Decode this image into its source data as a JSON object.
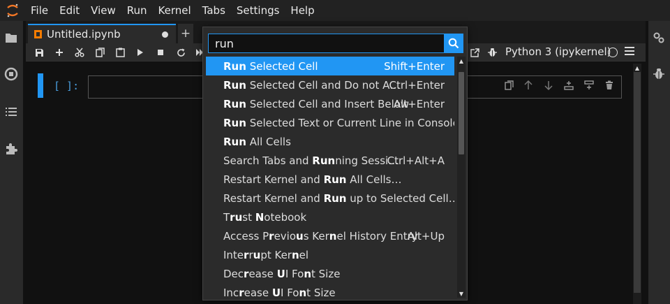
{
  "menubar": {
    "items": [
      "File",
      "Edit",
      "View",
      "Run",
      "Kernel",
      "Tabs",
      "Settings",
      "Help"
    ]
  },
  "tabs": {
    "active_label": "Untitled.ipynb",
    "add_label": "+"
  },
  "toolbar": {
    "kernel_name": "Python 3 (ipykernel)"
  },
  "cell": {
    "prompt": "[ ]:"
  },
  "palette": {
    "query": "run",
    "items": [
      {
        "parts": [
          [
            "Run",
            true
          ],
          [
            " Selected Cell",
            false
          ]
        ],
        "shortcut": "Shift+Enter",
        "active": true
      },
      {
        "parts": [
          [
            "Run",
            true
          ],
          [
            " Selected Cell and Do not A…",
            false
          ]
        ],
        "shortcut": "Ctrl+Enter"
      },
      {
        "parts": [
          [
            "Run",
            true
          ],
          [
            " Selected Cell and Insert Below",
            false
          ]
        ],
        "shortcut": "Alt+Enter"
      },
      {
        "parts": [
          [
            "Run",
            true
          ],
          [
            " Selected Text or Current Line in Console",
            false
          ]
        ],
        "shortcut": ""
      },
      {
        "parts": [
          [
            "Run",
            true
          ],
          [
            " All Cells",
            false
          ]
        ],
        "shortcut": ""
      },
      {
        "parts": [
          [
            "Search Tabs and ",
            false
          ],
          [
            "Run",
            true
          ],
          [
            "ning Sessi…",
            false
          ]
        ],
        "shortcut": "Ctrl+Alt+A"
      },
      {
        "parts": [
          [
            "Restart Kernel and ",
            false
          ],
          [
            "Run",
            true
          ],
          [
            " All Cells…",
            false
          ]
        ],
        "shortcut": ""
      },
      {
        "parts": [
          [
            "Restart Kernel and ",
            false
          ],
          [
            "Run",
            true
          ],
          [
            " up to Selected Cell…",
            false
          ]
        ],
        "shortcut": ""
      },
      {
        "parts": [
          [
            "T",
            false
          ],
          [
            "ru",
            true
          ],
          [
            "st ",
            false
          ],
          [
            "N",
            true
          ],
          [
            "otebook",
            false
          ]
        ],
        "shortcut": ""
      },
      {
        "parts": [
          [
            "Access P",
            false
          ],
          [
            "r",
            true
          ],
          [
            "evio",
            false
          ],
          [
            "u",
            true
          ],
          [
            "s Ker",
            false
          ],
          [
            "n",
            true
          ],
          [
            "el History Entry",
            false
          ]
        ],
        "shortcut": "Alt+Up"
      },
      {
        "parts": [
          [
            "Inte",
            false
          ],
          [
            "r",
            true
          ],
          [
            "r",
            false
          ],
          [
            "u",
            true
          ],
          [
            "pt Ker",
            false
          ],
          [
            "n",
            true
          ],
          [
            "el",
            false
          ]
        ],
        "shortcut": ""
      },
      {
        "parts": [
          [
            "Dec",
            false
          ],
          [
            "r",
            true
          ],
          [
            "ease ",
            false
          ],
          [
            "U",
            true
          ],
          [
            "I Fo",
            false
          ],
          [
            "n",
            true
          ],
          [
            "t Size",
            false
          ]
        ],
        "shortcut": ""
      },
      {
        "parts": [
          [
            "Inc",
            false
          ],
          [
            "r",
            true
          ],
          [
            "ease ",
            false
          ],
          [
            "U",
            true
          ],
          [
            "I Fo",
            false
          ],
          [
            "n",
            true
          ],
          [
            "t Size",
            false
          ]
        ],
        "shortcut": ""
      }
    ]
  },
  "icons": {
    "logo": "jupyter-logo-icon",
    "sidebar_left": [
      "folder-icon",
      "running-sessions-icon",
      "table-of-contents-icon",
      "extension-icon"
    ],
    "sidebar_right": [
      "property-inspector-icon",
      "debugger-icon"
    ]
  },
  "colors": {
    "accent": "#2196f3",
    "notebook_icon": "#f57c00",
    "logo": "#f37726"
  }
}
